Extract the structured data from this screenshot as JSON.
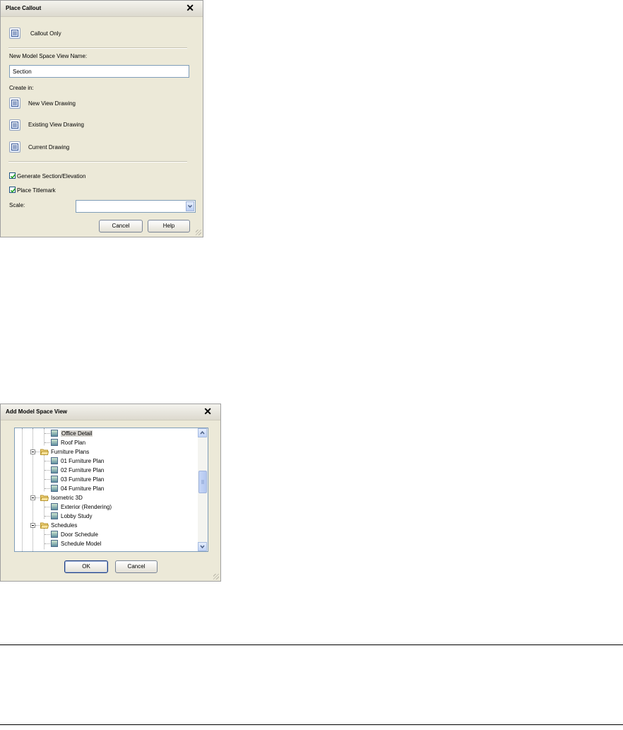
{
  "place_callout": {
    "title": "Place Callout",
    "callout_only": "Callout Only",
    "view_name_label": "New Model Space View Name:",
    "view_name_value": "Section",
    "create_in_label": "Create in:",
    "new_view_drawing": "New View Drawing",
    "existing_view_drawing": "Existing View Drawing",
    "current_drawing": "Current Drawing",
    "generate_section": "Generate Section/Elevation",
    "generate_section_checked": true,
    "place_titlemark": "Place Titlemark",
    "place_titlemark_checked": true,
    "scale_label": "Scale:",
    "scale_value": "",
    "cancel_label": "Cancel",
    "help_label": "Help"
  },
  "add_model_space_view": {
    "title": "Add Model Space View",
    "tree": [
      {
        "label": "Office Detail",
        "kind": "view",
        "level": 2,
        "selected": true
      },
      {
        "label": "Roof Plan",
        "kind": "view",
        "level": 2
      },
      {
        "label": "Furniture Plans",
        "kind": "folder",
        "level": 1
      },
      {
        "label": "01 Furniture Plan",
        "kind": "view",
        "level": 2
      },
      {
        "label": "02 Furniture Plan",
        "kind": "view",
        "level": 2
      },
      {
        "label": "03 Furniture Plan",
        "kind": "view",
        "level": 2
      },
      {
        "label": "04 Furniture Plan",
        "kind": "view",
        "level": 2
      },
      {
        "label": "Isometric 3D",
        "kind": "folder",
        "level": 1
      },
      {
        "label": "Exterior (Rendering)",
        "kind": "view",
        "level": 2
      },
      {
        "label": "Lobby Study",
        "kind": "view",
        "level": 2
      },
      {
        "label": "Schedules",
        "kind": "folder",
        "level": 1
      },
      {
        "label": "Door Schedule",
        "kind": "view",
        "level": 2
      },
      {
        "label": "Schedule Model",
        "kind": "view",
        "level": 2
      }
    ],
    "ok_label": "OK",
    "cancel_label": "Cancel"
  }
}
